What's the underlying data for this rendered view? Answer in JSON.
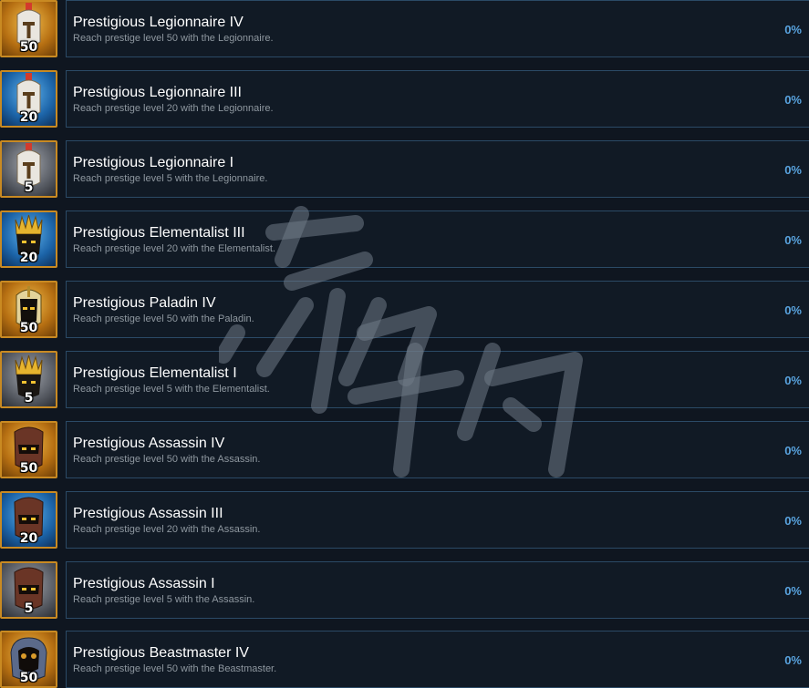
{
  "achievements": [
    {
      "title": "Prestigious Legionnaire IV",
      "description": "Reach prestige level 50 with the Legionnaire.",
      "percent": "0%",
      "icon": "legionnaire-helmet-icon",
      "level_badge": "50",
      "tier_color": "#e0a32e"
    },
    {
      "title": "Prestigious Legionnaire III",
      "description": "Reach prestige level 20 with the Legionnaire.",
      "percent": "0%",
      "icon": "legionnaire-helmet-icon",
      "level_badge": "20",
      "tier_color": "#2f86cf"
    },
    {
      "title": "Prestigious Legionnaire I",
      "description": "Reach prestige level 5 with the Legionnaire.",
      "percent": "0%",
      "icon": "legionnaire-helmet-icon",
      "level_badge": "5",
      "tier_color": "#767a82"
    },
    {
      "title": "Prestigious Elementalist III",
      "description": "Reach prestige level 20 with the Elementalist.",
      "percent": "0%",
      "icon": "elementalist-crown-icon",
      "level_badge": "20",
      "tier_color": "#2f86cf"
    },
    {
      "title": "Prestigious Paladin IV",
      "description": "Reach prestige level 50 with the Paladin.",
      "percent": "0%",
      "icon": "paladin-helmet-icon",
      "level_badge": "50",
      "tier_color": "#e0a32e"
    },
    {
      "title": "Prestigious Elementalist I",
      "description": "Reach prestige level 5 with the Elementalist.",
      "percent": "0%",
      "icon": "elementalist-crown-icon",
      "level_badge": "5",
      "tier_color": "#767a82"
    },
    {
      "title": "Prestigious Assassin IV",
      "description": "Reach prestige level 50 with the Assassin.",
      "percent": "0%",
      "icon": "assassin-mask-icon",
      "level_badge": "50",
      "tier_color": "#e0a32e"
    },
    {
      "title": "Prestigious Assassin III",
      "description": "Reach prestige level 20 with the Assassin.",
      "percent": "0%",
      "icon": "assassin-mask-icon",
      "level_badge": "20",
      "tier_color": "#2f86cf"
    },
    {
      "title": "Prestigious Assassin I",
      "description": "Reach prestige level 5 with the Assassin.",
      "percent": "0%",
      "icon": "assassin-mask-icon",
      "level_badge": "5",
      "tier_color": "#767a82"
    },
    {
      "title": "Prestigious Beastmaster IV",
      "description": "Reach prestige level 50 with the Beastmaster.",
      "percent": "0%",
      "icon": "beastmaster-hood-icon",
      "level_badge": "50",
      "tier_color": "#e0a32e"
    }
  ],
  "watermark": {
    "text": "游侠网",
    "icon": "watermark-logo"
  },
  "colors": {
    "background": "#0f1620",
    "panel": "#111a25",
    "panel_border": "#2b4a66",
    "title": "#ffffff",
    "description": "#8f98a0",
    "percent": "#59a4e0",
    "icon_frame": "#c98a22"
  }
}
